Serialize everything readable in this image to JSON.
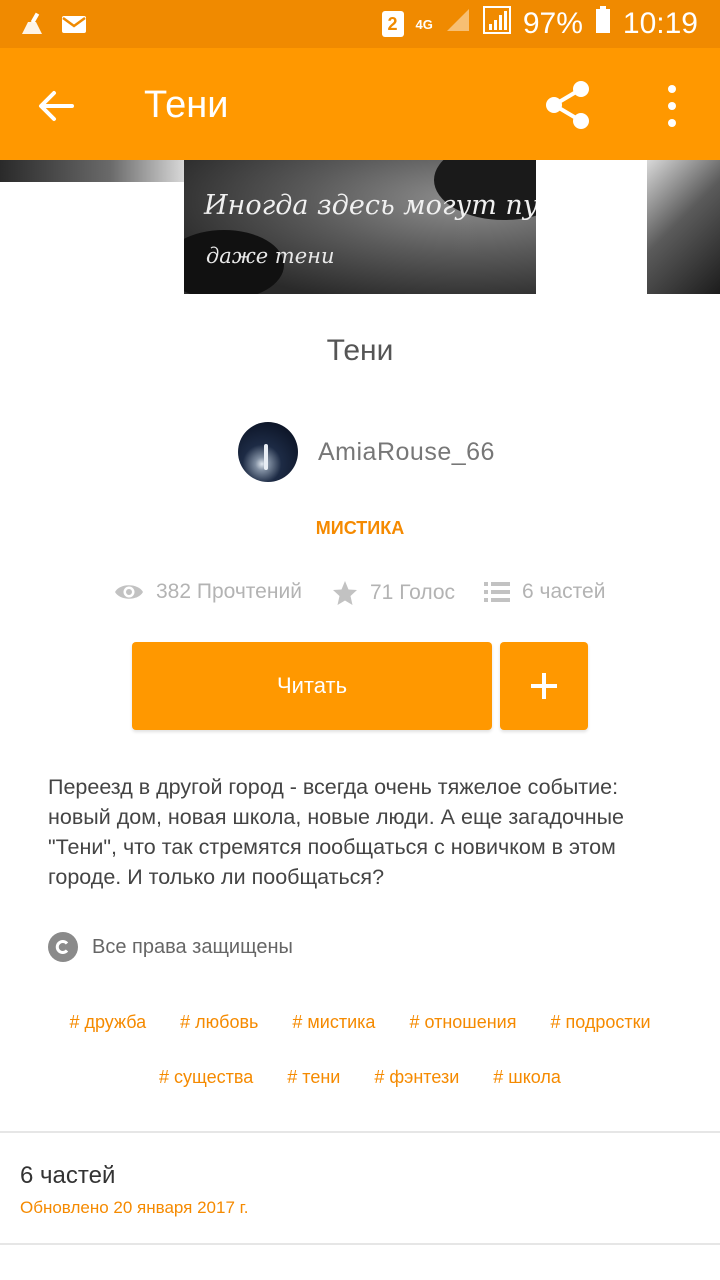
{
  "status_bar": {
    "sim_badge": "2",
    "network": "4G",
    "battery": "97%",
    "time": "10:19"
  },
  "app_bar": {
    "title": "Тени"
  },
  "cover": {
    "line1": "Иногда здесь могут пугать",
    "line2": "даже тени"
  },
  "story": {
    "title": "Тени",
    "author": "AmiaRouse_66",
    "genre": "МИСТИКА",
    "stats": {
      "reads": "382 Прочтений",
      "votes": "71 Голос",
      "parts": "6 частей"
    },
    "read_label": "Читать",
    "add_label": "+",
    "description": "Переезд в другой город - всегда очень тяжелое событие: новый дом, новая школа, новые люди. А еще загадочные \"Тени\", что так стремятся пообщаться с новичком в этом городе. И только ли пообщаться?",
    "copyright": "Все права защищены"
  },
  "tags": {
    "row1": [
      "# дружба",
      "# любовь",
      "# мистика",
      "# отношения",
      "# подростки"
    ],
    "row2": [
      "# существа",
      "# тени",
      "# фэнтези",
      "# школа"
    ]
  },
  "parts_section": {
    "title": "6 частей",
    "updated": "Обновлено 20 января 2017 г."
  },
  "colors": {
    "app_bar": "#ff9800",
    "status_bar": "#f08a00",
    "accent_text": "#f58a00"
  }
}
